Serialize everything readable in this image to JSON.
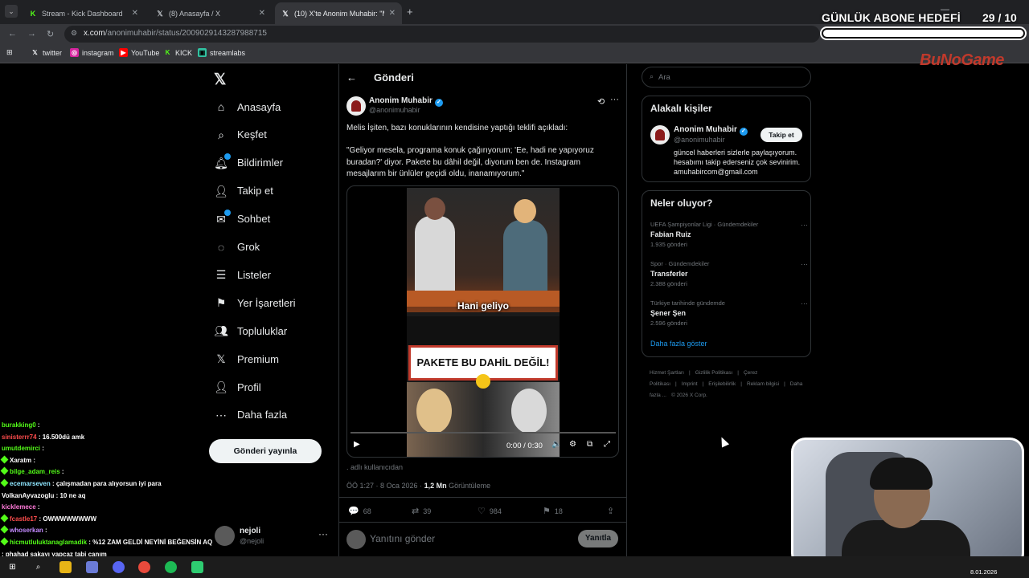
{
  "browser": {
    "tabs": [
      {
        "title": "Stream - Kick Dashboard",
        "icon": "kick-icon",
        "active": false
      },
      {
        "title": "(8) Anasayfa / X",
        "icon": "x-logo-icon",
        "active": false
      },
      {
        "title": "(10) X'te Anonim Muhabir: \"Me",
        "icon": "x-logo-icon",
        "active": true
      }
    ],
    "url_host": "x.com",
    "url_path": "/anonimuhabir/status/2009029143287988715",
    "bookmarks": [
      "twitter",
      "instagram",
      "YouTube",
      "KICK",
      "streamlabs"
    ]
  },
  "overlay": {
    "sub_goal_label": "GÜNLÜK ABONE HEDEFİ",
    "sub_goal_count": "29  / 10",
    "sub_goal_progress": 1.0,
    "brand": "BuNoGame"
  },
  "nav": {
    "items": [
      {
        "label": "Anasayfa",
        "icon": "home-icon",
        "badge": false
      },
      {
        "label": "Keşfet",
        "icon": "search-icon",
        "badge": false
      },
      {
        "label": "Bildirimler",
        "icon": "bell-icon",
        "badge": true
      },
      {
        "label": "Takip et",
        "icon": "add-user-icon",
        "badge": false
      },
      {
        "label": "Sohbet",
        "icon": "mail-icon",
        "badge": true
      },
      {
        "label": "Grok",
        "icon": "grok-icon",
        "badge": false
      },
      {
        "label": "Listeler",
        "icon": "list-icon",
        "badge": false
      },
      {
        "label": "Yer İşaretleri",
        "icon": "bookmark-icon",
        "badge": false
      },
      {
        "label": "Topluluklar",
        "icon": "communities-icon",
        "badge": false
      },
      {
        "label": "Premium",
        "icon": "x-logo-icon",
        "badge": false
      },
      {
        "label": "Profil",
        "icon": "profile-icon",
        "badge": false
      },
      {
        "label": "Daha fazla",
        "icon": "more-circle-icon",
        "badge": false
      }
    ],
    "post_button": "Gönderi yayınla",
    "account_name": "nejoli",
    "account_handle": "@nejoli"
  },
  "post": {
    "header_title": "Gönderi",
    "author_name": "Anonim Muhabir",
    "author_handle": "@anonimuhabir",
    "para1": "Melis İşiten, bazı konuklarının kendisine yaptığı teklifi açıkladı:",
    "para2": "\"Geliyor mesela, programa konuk çağırıyorum; 'Ee, hadi ne yapıyoruz buradan?' diyor. Pakete bu dâhil değil, diyorum ben de. Instagram mesajlarım bir ünlüler geçidi oldu, inanamıyorum.\"",
    "video": {
      "caption_top": "Hani geliyo",
      "caption_main": "PAKETE BU DAHİL DEĞİL!",
      "time": "0:00 / 0:30",
      "progress": 0
    },
    "alt_text": ". adlı kullanıcıdan",
    "timestamp": "ÖÖ 1:27 · 8 Oca 2026 · ",
    "views": "1,2 Mn",
    "views_label": " Görüntüleme",
    "actions": {
      "replies": "68",
      "reposts": "39",
      "likes": "984",
      "bookmarks": "18"
    },
    "reply_placeholder": "Yanıtını gönder",
    "reply_button": "Yanıtla"
  },
  "sidebar": {
    "search_placeholder": "Ara",
    "related_title": "Alakalı kişiler",
    "related_name": "Anonim Muhabir",
    "related_handle": "@anonimuhabir",
    "follow_label": "Takip et",
    "related_bio": "güncel haberleri sizlerle paylaşıyorum. hesabımı takip ederseniz çok sevinirim. amuhabircom@gmail.com",
    "trends_title": "Neler oluyor?",
    "trends": [
      {
        "category": "UEFA Şampiyonlar Ligi · Gündemdekiler",
        "name": "Fabian Ruiz",
        "posts": "1.935 gönderi"
      },
      {
        "category": "Spor · Gündemdekiler",
        "name": "Transferler",
        "posts": "2.388 gönderi"
      },
      {
        "category": "Türkiye tarihinde gündemde",
        "name": "Şener Şen",
        "posts": "2.596 gönderi"
      }
    ],
    "show_more": "Daha fazla göster",
    "footer": [
      "Hizmet Şartları",
      "|",
      "Gizlilik Politikası",
      "|",
      "Çerez Politikası",
      "|",
      "Imprint",
      "|",
      "Erişilebilirlik",
      "|",
      "Reklam bilgisi",
      "|",
      "Daha fazla ...",
      "© 2026 X Corp."
    ]
  },
  "chat": [
    {
      "user": "burakking0",
      "msg": "",
      "color": "#53fc18",
      "badge": false
    },
    {
      "user": "sinisterrr74",
      "msg": "16.500dü amk",
      "color": "#ff4d4d",
      "badge": false
    },
    {
      "user": "umutdemirci",
      "msg": "",
      "color": "#53fc18",
      "badge": false
    },
    {
      "user": "Xaratm",
      "msg": "",
      "color": "#ffffff",
      "badge": true
    },
    {
      "user": "bilge_adam_reis",
      "msg": "",
      "color": "#53fc18",
      "badge": true
    },
    {
      "user": "ecemarseven",
      "msg": "çalışmadan para alıyorsun iyi para",
      "color": "#8ee6ff",
      "badge": true
    },
    {
      "user": "VolkanAyvazoglu",
      "msg": "10 ne aq",
      "color": "#ffffff",
      "badge": false
    },
    {
      "user": "kicklemece",
      "msg": "",
      "color": "#ff7ad9",
      "badge": false
    },
    {
      "user": "fcastle17",
      "msg": "OWWWWWWWW",
      "color": "#ff4d4d",
      "badge": true
    },
    {
      "user": "whoserkan",
      "msg": "",
      "color": "#c48bff",
      "badge": true
    },
    {
      "user": "hicmutluluktanaglamadik",
      "msg": "%12 ZAM GELDİ NEYİNİ BEĞENSİN AQ",
      "color": "#53fc18",
      "badge": true
    },
    {
      "user": "",
      "msg": ": phahad şakayı yapcaz tabi canım",
      "color": "#ffffff",
      "badge": false
    }
  ],
  "taskbar": {
    "icons": [
      "windows-start-icon",
      "search-icon",
      "file-explorer-icon",
      "app-icon",
      "discord-icon",
      "chrome-icon",
      "spotify-icon",
      "app-icon-2"
    ],
    "date": "8.01.2026"
  }
}
